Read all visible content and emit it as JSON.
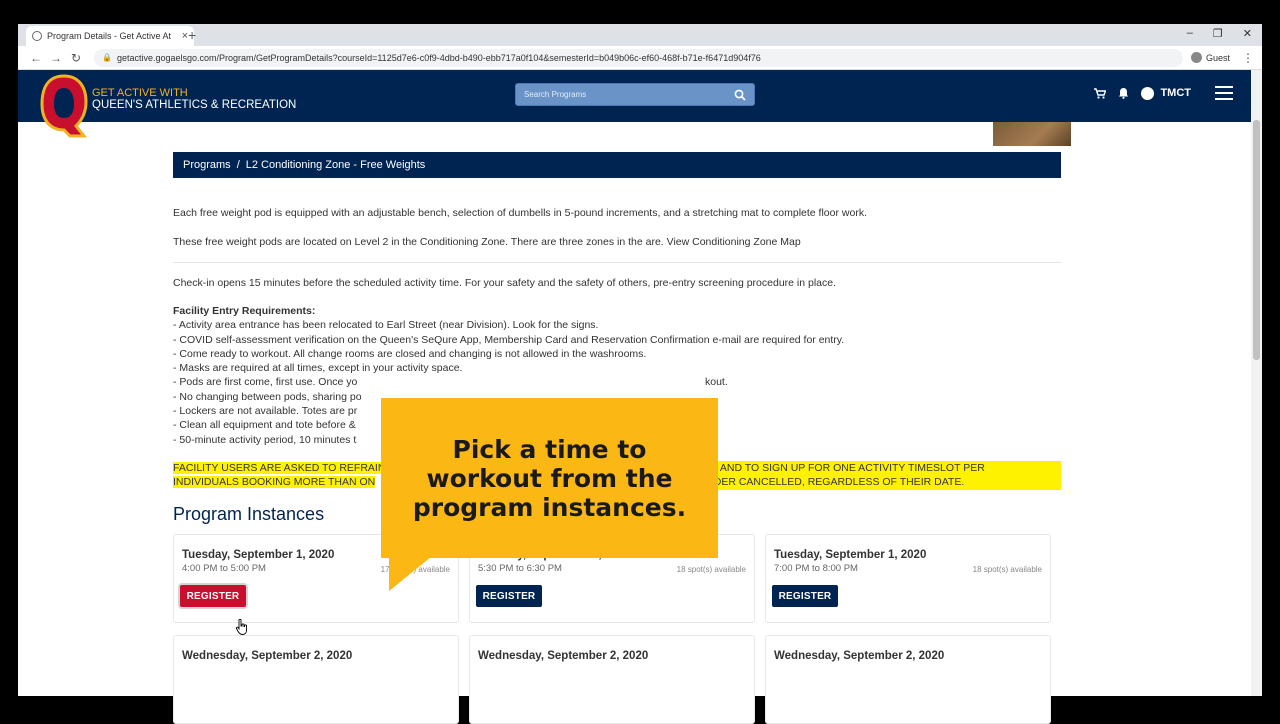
{
  "browser": {
    "tab_title": "Program Details - Get Active At",
    "tab_close": "×",
    "new_tab": "+",
    "url": "getactive.gogaelsgo.com/Program/GetProgramDetails?courseId=1125d7e6-c0f9-4dbd-b490-ebb717a0f104&semesterId=b049b06c-ef60-468f-b71e-f6471d904f76",
    "profile_label": "Guest",
    "back": "←",
    "forward": "→",
    "reload": "↻",
    "minimize": "–",
    "restore": "❐",
    "close": "✕",
    "menu": "⋮"
  },
  "header": {
    "brand_line1": "GET ACTIVE WITH",
    "brand_line2": "QUEEN'S ATHLETICS & RECREATION",
    "search_placeholder": "Search Programs",
    "user_initials": "TMCT",
    "cart_icon": "🛒",
    "bell_icon": "🔔"
  },
  "breadcrumb": {
    "root": "Programs",
    "separator": "/",
    "current": "L2 Conditioning Zone - Free Weights"
  },
  "description": {
    "p1": "Each free weight pod is equipped with an adjustable bench, selection of dumbells in 5-pound increments, and a stretching mat to complete floor work.",
    "p2": "These free weight pods are located on Level 2 in the Conditioning Zone. There are three zones in the are.",
    "p2_link": "View Conditioning Zone Map",
    "p3": "Check-in opens 15 minutes before the scheduled activity time. For your safety and the safety of others, pre-entry screening procedure in place.",
    "requirements_heading": "Facility Entry Requirements:",
    "requirements": [
      "- Activity area entrance has been relocated to Earl Street (near Division). Look for the signs.",
      "- COVID self-assessment verification on the Queen's SeQure App, Membership Card and Reservation Confirmation e-mail are required for entry.",
      "- Come ready to workout. All change rooms are closed and changing is not allowed in the washrooms.",
      "- Masks are required at all times, except in your activity space.",
      "- Pods are first come, first use. Once yo",
      "- No changing between pods, sharing po",
      "- Lockers are not available. Totes are pr",
      "- Clean all equipment and tote before &",
      "- 50-minute activity period, 10 minutes t"
    ],
    "requirements_tail": "kout.",
    "warning_line1a": "FACILITY USERS ARE ASKED TO REFRAIN",
    "warning_line1b": "Y, AND TO SIGN UP FOR ONE ACTIVITY TIMESLOT PER TRANSACTION.",
    "warning_line2a": "INDIVIDUALS BOOKING MORE THAN ON",
    "warning_line2b": "ORDER CANCELLED, REGARDLESS OF THEIR DATE."
  },
  "instances_heading": "Program Instances",
  "instances": [
    {
      "date": "Tuesday, September 1, 2020",
      "time": "4:00 PM to 5:00 PM",
      "spots": "17 spot(s) available",
      "button": "REGISTER"
    },
    {
      "date": "Tuesday, September 1, 2020",
      "time": "5:30 PM to 6:30 PM",
      "spots": "18 spot(s) available",
      "button": "REGISTER"
    },
    {
      "date": "Tuesday, September 1, 2020",
      "time": "7:00 PM to 8:00 PM",
      "spots": "18 spot(s) available",
      "button": "REGISTER"
    },
    {
      "date": "Wednesday, September 2, 2020",
      "time": "",
      "spots": "",
      "button": ""
    },
    {
      "date": "Wednesday, September 2, 2020",
      "time": "",
      "spots": "",
      "button": ""
    },
    {
      "date": "Wednesday, September 2, 2020",
      "time": "",
      "spots": "",
      "button": ""
    }
  ],
  "callout": {
    "text": "Pick a time to workout from the program instances."
  },
  "colors": {
    "navy": "#002452",
    "gold": "#f0b323",
    "callout": "#fbb714",
    "highlight": "#fff200",
    "register_active": "#c8102e"
  }
}
